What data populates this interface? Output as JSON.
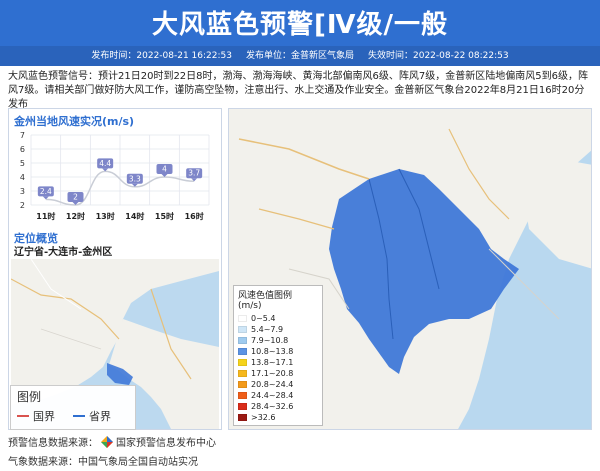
{
  "header": {
    "title": "大风蓝色预警[Ⅳ级/一般",
    "publish_time": "发布时间：2022-08-21 16:22:53",
    "publisher": "发布单位：金普新区气象局",
    "expire_time": "失效时间：2022-08-22 08:22:53"
  },
  "description": "大风蓝色预警信号：预计21日20时到22日8时，渤海、渤海海峡、黄海北部偏南风6级、阵风7级，金普新区陆地偏南风5到6级，阵风7级。请相关部门做好防大风工作，谨防高空坠物，注意出行、水上交通及作业安全。金普新区气象台2022年8月21日16时20分发布",
  "wind_panel": {
    "title": "金州当地风速实况(m/s)"
  },
  "location_panel": {
    "title": "定位概览",
    "region": "辽宁省-大连市-金州区"
  },
  "map_legend": {
    "title": "图例",
    "national_border": "国界",
    "provincial_border": "省界",
    "national_color": "#d9534f",
    "provincial_color": "#2f6fd0"
  },
  "wind_scale": {
    "title": "风速色值图例 (m/s)",
    "items": [
      {
        "label": "0~5.4",
        "color": "#ffffff"
      },
      {
        "label": "5.4~7.9",
        "color": "#cfe6f7"
      },
      {
        "label": "7.9~10.8",
        "color": "#9fcbef"
      },
      {
        "label": "10.8~13.8",
        "color": "#5b93e4"
      },
      {
        "label": "13.8~17.1",
        "color": "#f5d31c"
      },
      {
        "label": "17.1~20.8",
        "color": "#f6b81c"
      },
      {
        "label": "20.8~24.4",
        "color": "#f39a1a"
      },
      {
        "label": "24.4~28.4",
        "color": "#ef5e19"
      },
      {
        "label": "28.4~32.6",
        "color": "#d92c1a"
      },
      {
        "label": ">32.6",
        "color": "#9b1a14"
      }
    ]
  },
  "footer": {
    "warning_source": "预警信息数据来源：",
    "warning_source_name": "国家预警信息发布中心",
    "weather_source": "气象数据来源：中国气象局全国自动站实况"
  },
  "chart_data": {
    "type": "line",
    "title": "金州当地风速实况(m/s)",
    "categories": [
      "11时",
      "12时",
      "13时",
      "14时",
      "15时",
      "16时"
    ],
    "values": [
      2.4,
      2,
      4.4,
      3.3,
      4,
      3.7
    ],
    "ylim": [
      2,
      7
    ],
    "yticks": [
      "2",
      "3",
      "4",
      "5",
      "6",
      "7"
    ],
    "grid": true,
    "line_color": "#c9cdd6",
    "label_color": "#7e86c9"
  }
}
